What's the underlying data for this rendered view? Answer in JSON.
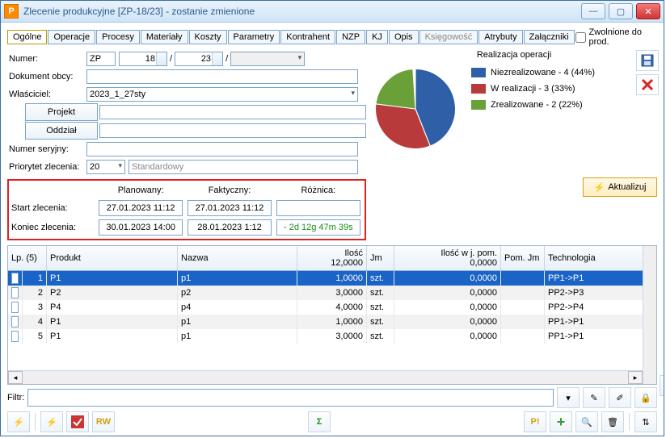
{
  "window": {
    "title": "Zlecenie produkcyjne  [ZP-18/23] - zostanie zmienione"
  },
  "tabs": [
    "Ogólne",
    "Operacje",
    "Procesy",
    "Materiały",
    "Koszty",
    "Parametry",
    "Kontrahent",
    "NZP",
    "KJ",
    "Opis",
    "Księgowość",
    "Atrybuty",
    "Załączniki"
  ],
  "free_prod_label": "Zwolnione do prod.",
  "form": {
    "numer_label": "Numer:",
    "numer_prefix": "ZP",
    "numer_a": "18",
    "numer_b": "23",
    "dok_obcy_label": "Dokument obcy:",
    "dok_obcy": "",
    "wlasciciel_label": "Właściciel:",
    "wlasciciel": "2023_1_27sty",
    "projekt_btn": "Projekt",
    "projekt": "",
    "oddzial_btn": "Oddział",
    "oddzial": "",
    "numer_ser_label": "Numer seryjny:",
    "numer_ser": "",
    "priorytet_label": "Priorytet zlecenia:",
    "priorytet": "20",
    "priorytet_txt": "Standardowy"
  },
  "dates": {
    "col_plan": "Planowany:",
    "col_fakt": "Faktyczny:",
    "col_diff": "Różnica:",
    "start_label": "Start zlecenia:",
    "start_plan": "27.01.2023 11:12",
    "start_fakt": "27.01.2023 11:12",
    "start_diff": "",
    "end_label": "Koniec zlecenia:",
    "end_plan": "30.01.2023 14:00",
    "end_fakt": "28.01.2023 1:12",
    "end_diff": "- 2d 12g 47m 39s"
  },
  "right": {
    "title": "Realizacja operacji",
    "legend": [
      {
        "color": "#2f5fa6",
        "label": "Niezrealizowane - 4 (44%)"
      },
      {
        "color": "#b83a3a",
        "label": "W realizacji - 3 (33%)"
      },
      {
        "color": "#6aa038",
        "label": "Zrealizowane - 2 (22%)"
      }
    ],
    "aktual": "Aktualizuj"
  },
  "chart_data": {
    "type": "pie",
    "title": "Realizacja operacji",
    "series": [
      {
        "name": "Niezrealizowane",
        "value": 4,
        "pct": 44,
        "color": "#2f5fa6"
      },
      {
        "name": "W realizacji",
        "value": 3,
        "pct": 33,
        "color": "#b83a3a"
      },
      {
        "name": "Zrealizowane",
        "value": 2,
        "pct": 22,
        "color": "#6aa038"
      }
    ]
  },
  "grid": {
    "lp_header": "Lp. (5)",
    "cols": [
      "Produkt",
      "Nazwa",
      "Ilość",
      "Jm",
      "Ilość w j. pom.",
      "Pom. Jm",
      "Technologia"
    ],
    "sum_ilosc": "12,0000",
    "sum_ilosc_pom": "0,0000",
    "rows": [
      {
        "lp": "1",
        "produkt": "P1",
        "nazwa": "p1",
        "ilosc": "1,0000",
        "jm": "szt.",
        "ilosc_pom": "0,0000",
        "pomjm": "",
        "tech": "PP1->P1",
        "sel": true
      },
      {
        "lp": "2",
        "produkt": "P2",
        "nazwa": "p2",
        "ilosc": "3,0000",
        "jm": "szt.",
        "ilosc_pom": "0,0000",
        "pomjm": "",
        "tech": "PP2->P3"
      },
      {
        "lp": "3",
        "produkt": "P4",
        "nazwa": "p4",
        "ilosc": "4,0000",
        "jm": "szt.",
        "ilosc_pom": "0,0000",
        "pomjm": "",
        "tech": "PP2->P4"
      },
      {
        "lp": "4",
        "produkt": "P1",
        "nazwa": "p1",
        "ilosc": "1,0000",
        "jm": "szt.",
        "ilosc_pom": "0,0000",
        "pomjm": "",
        "tech": "PP1->P1"
      },
      {
        "lp": "5",
        "produkt": "P1",
        "nazwa": "p1",
        "ilosc": "3,0000",
        "jm": "szt.",
        "ilosc_pom": "0,0000",
        "pomjm": "",
        "tech": "PP1->P1"
      }
    ]
  },
  "filtr_label": "Filtr:",
  "cols_w": {
    "cb": 18,
    "lp": 30,
    "produkt": 162,
    "nazwa": 148,
    "ilosc": 86,
    "jm": 34,
    "ilosc_pom": 132,
    "pomjm": 54,
    "tech": 96
  }
}
